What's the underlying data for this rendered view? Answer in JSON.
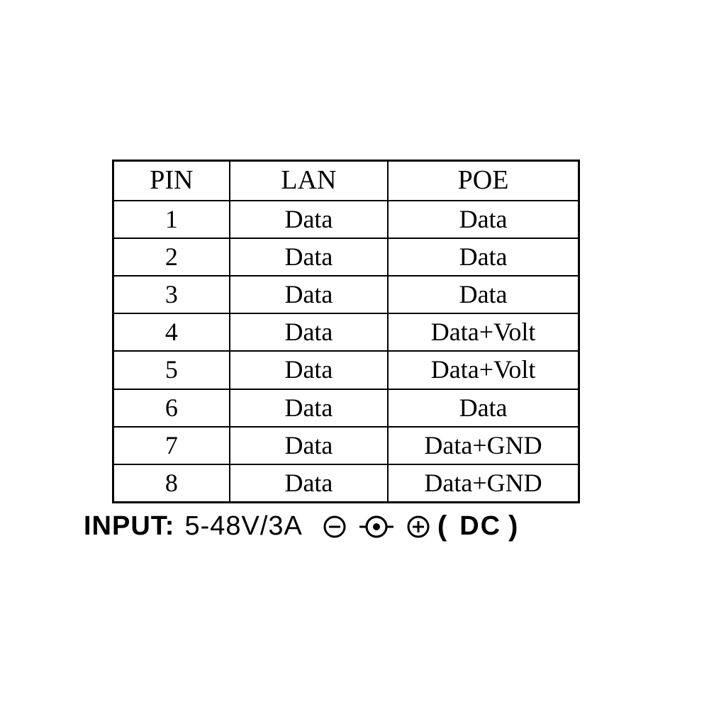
{
  "table": {
    "headers": {
      "pin": "PIN",
      "lan": "LAN",
      "poe": "POE"
    },
    "rows": [
      {
        "pin": "1",
        "lan": "Data",
        "poe": "Data"
      },
      {
        "pin": "2",
        "lan": "Data",
        "poe": "Data"
      },
      {
        "pin": "3",
        "lan": "Data",
        "poe": "Data"
      },
      {
        "pin": "4",
        "lan": "Data",
        "poe": "Data+Volt"
      },
      {
        "pin": "5",
        "lan": "Data",
        "poe": "Data+Volt"
      },
      {
        "pin": "6",
        "lan": "Data",
        "poe": "Data"
      },
      {
        "pin": "7",
        "lan": "Data",
        "poe": "Data+GND"
      },
      {
        "pin": "8",
        "lan": "Data",
        "poe": "Data+GND"
      }
    ]
  },
  "input": {
    "label": "INPUT:",
    "value": "5-48V/3A",
    "dc_open": "(",
    "dc_label": "DC",
    "dc_close": ")"
  }
}
